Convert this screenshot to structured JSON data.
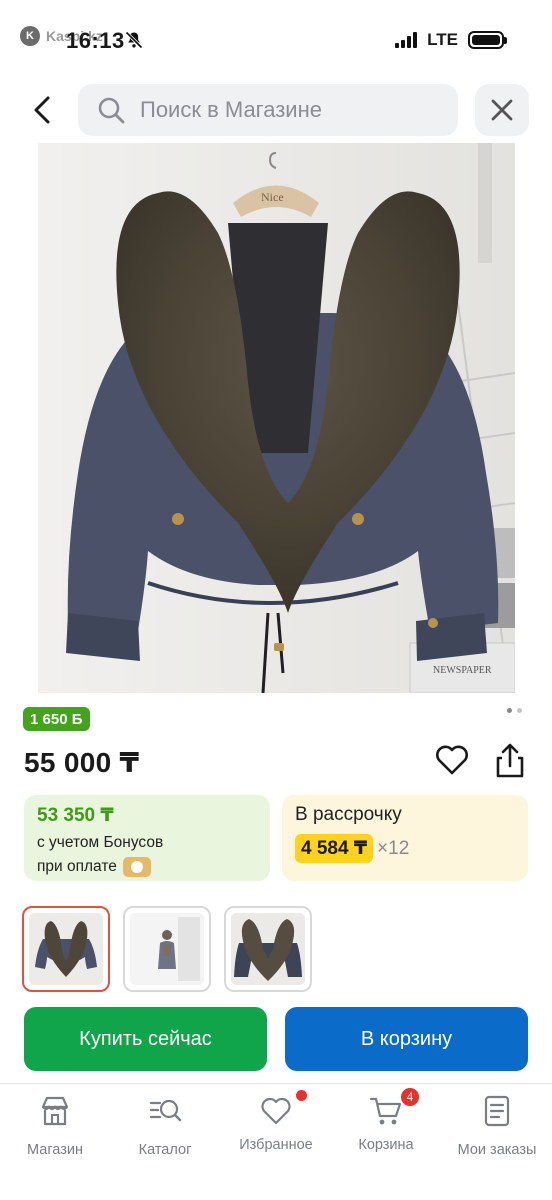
{
  "status_bar": {
    "app_logo_letter": "K",
    "app_name": "Kaspi.kz",
    "time": "16:13",
    "network": "LTE"
  },
  "search": {
    "placeholder": "Поиск в Магазине"
  },
  "product": {
    "bonus_badge": "1 650 Б",
    "price": "55 000 ₸",
    "bonus_card": {
      "price": "53 350 ₸",
      "line1": "с учетом Бонусов",
      "line2": "при оплате"
    },
    "installment": {
      "title": "В рассрочку",
      "amount": "4 584 ₸",
      "times": "×12"
    },
    "gallery": {
      "total_images": 3,
      "active_index": 0,
      "hanger_text": "Nice"
    }
  },
  "actions": {
    "buy_label": "Купить сейчас",
    "cart_label": "В корзину"
  },
  "bottom_nav": {
    "items": [
      {
        "label": "Магазин",
        "icon": "store-icon"
      },
      {
        "label": "Каталог",
        "icon": "catalog-search-icon"
      },
      {
        "label": "Избранное",
        "icon": "heart-icon"
      },
      {
        "label": "Корзина",
        "icon": "cart-icon",
        "badge": "4"
      },
      {
        "label": "Мои заказы",
        "icon": "orders-icon"
      }
    ]
  },
  "colors": {
    "accent_green": "#10a54a",
    "accent_blue": "#0b6bc9",
    "bonus_green": "#44a31c",
    "installment_yellow": "#ffd21f",
    "badge_red": "#e8312d"
  }
}
